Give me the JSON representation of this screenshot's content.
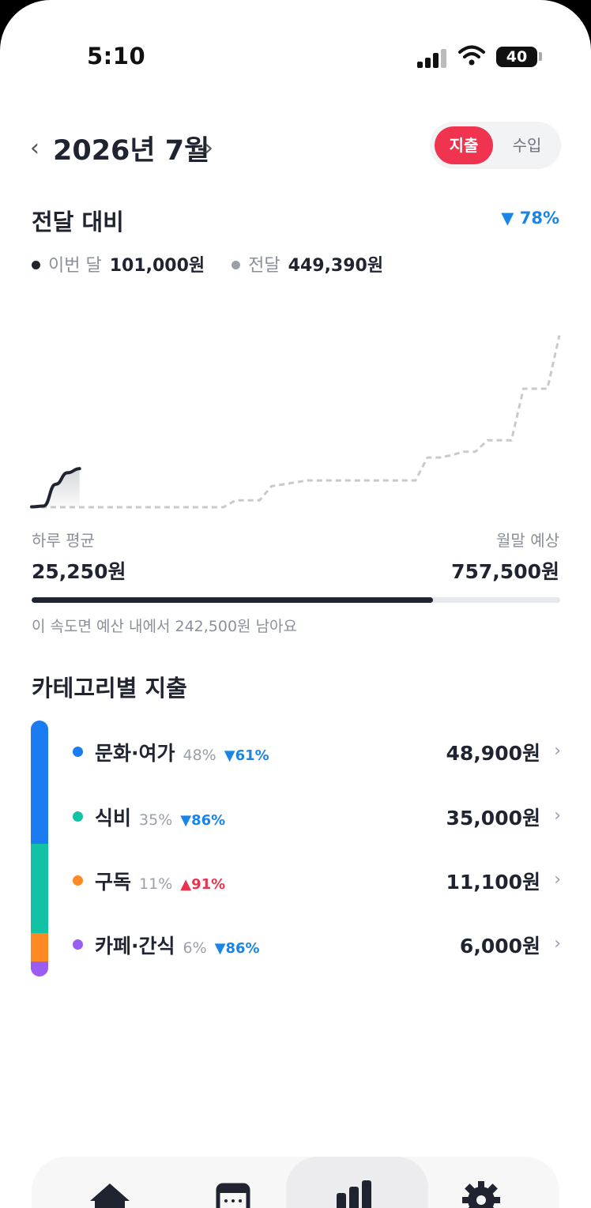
{
  "status_bar": {
    "time": "5:10",
    "battery": "40"
  },
  "header": {
    "prev": "‹",
    "title": "2026년 7월",
    "next": "›"
  },
  "toggle": {
    "active": "지출",
    "inactive": "수입"
  },
  "comparison": {
    "title": "전달 대비",
    "change": "▼ 78%",
    "this_month_label": "이번 달",
    "this_month_value": "101,000원",
    "last_month_label": "전달",
    "last_month_value": "449,390원"
  },
  "chart_data": {
    "type": "line",
    "series": [
      {
        "name": "이번 달",
        "color": "#1f2430",
        "style": "solid",
        "y": [
          1000,
          3000,
          60000,
          90000,
          101000
        ]
      },
      {
        "name": "전달",
        "color": "#c8cacf",
        "style": "dashed",
        "y": [
          0,
          0,
          0,
          0,
          0,
          0,
          0,
          0,
          0,
          0,
          0,
          0,
          0,
          0,
          0,
          0,
          0,
          18000,
          18000,
          18000,
          55000,
          60000,
          65000,
          70000,
          70000,
          70000,
          70000,
          70000,
          70000,
          70000,
          70000,
          70000,
          70000,
          130000,
          130000,
          136000,
          145000,
          145000,
          175000,
          175000,
          175000,
          310000,
          310000,
          310000,
          449390
        ]
      }
    ],
    "ylim": [
      0,
      500000
    ]
  },
  "daily_avg": {
    "label": "하루 평균",
    "value": "25,250원"
  },
  "projection": {
    "label": "월말 예상",
    "value": "757,500원"
  },
  "budget_progress": 0.76,
  "budget_note": "이 속도면 예산 내에서 242,500원 남아요",
  "categories_title": "카테고리별 지출",
  "categories": [
    {
      "name": "문화·여가",
      "share": "48%",
      "change": "▼61%",
      "direction": "down",
      "amount": "48,900원",
      "color": "#1a7cf0",
      "fraction": 0.48
    },
    {
      "name": "식비",
      "share": "35%",
      "change": "▼86%",
      "direction": "down",
      "amount": "35,000원",
      "color": "#12c2a4",
      "fraction": 0.35
    },
    {
      "name": "구독",
      "share": "11%",
      "change": "▲91%",
      "direction": "up",
      "amount": "11,100원",
      "color": "#ff8a24",
      "fraction": 0.11
    },
    {
      "name": "카페·간식",
      "share": "6%",
      "change": "▼86%",
      "direction": "down",
      "amount": "6,000원",
      "color": "#9b5cf2",
      "fraction": 0.06
    }
  ],
  "colors": {
    "accent": "#f0344f",
    "down": "#1a84e8",
    "up": "#e8344d"
  },
  "tabbar": {
    "icons": [
      "home-icon",
      "calendar-icon",
      "chart-icon",
      "gear-icon"
    ],
    "active_index": 2
  }
}
